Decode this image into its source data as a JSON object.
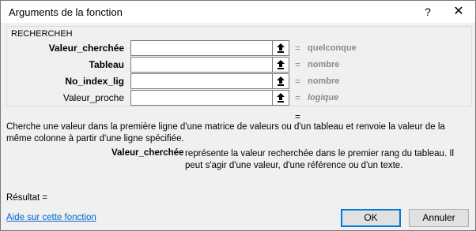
{
  "dialog": {
    "title": "Arguments de la fonction",
    "help_symbol": "?",
    "close_symbol": "✕"
  },
  "function": {
    "name": "RECHERCHEH",
    "arguments": [
      {
        "label": "Valeur_cherchée",
        "value": "",
        "result": "quelconque"
      },
      {
        "label": "Tableau",
        "value": "",
        "result": "nombre"
      },
      {
        "label": "No_index_lig",
        "value": "",
        "result": "nombre"
      },
      {
        "label": "Valeur_proche",
        "value": "",
        "result": "logique"
      }
    ],
    "equals": "=",
    "formula_result_eq": "="
  },
  "description": "Cherche une valeur dans la première ligne d'une matrice de valeurs ou d'un tableau et renvoie la valeur de la même colonne à partir d'une ligne spécifiée.",
  "parameter_help": {
    "name": "Valeur_cherchée",
    "text": "représente la valeur recherchée dans le premier rang du tableau. Il peut s'agir d'une valeur, d'une référence ou d'un texte."
  },
  "footer": {
    "result_label": "Résultat =",
    "help_link": "Aide sur cette fonction",
    "ok_label": "OK",
    "cancel_label": "Annuler"
  },
  "colors": {
    "accent": "#0078d7",
    "link": "#0066cc",
    "muted": "#8a8a8a"
  }
}
